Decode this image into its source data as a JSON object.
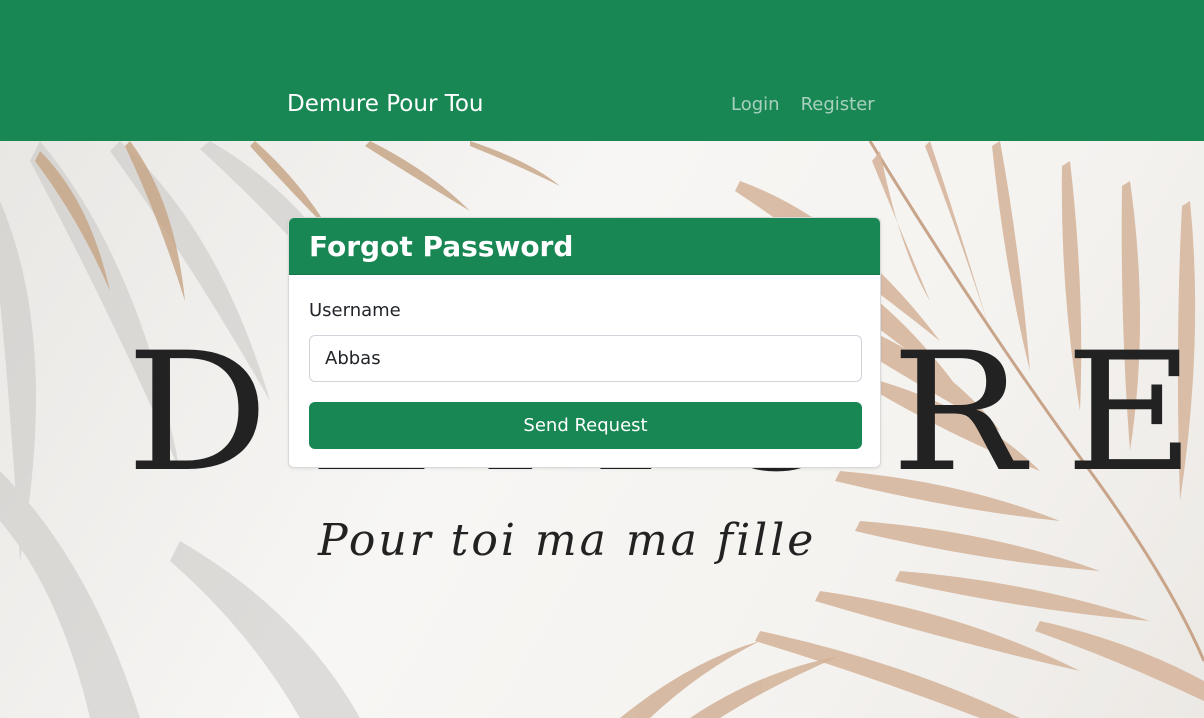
{
  "navbar": {
    "brand": "Demure Pour Tou",
    "links": [
      {
        "label": "Login"
      },
      {
        "label": "Register"
      }
    ],
    "color": "#198754"
  },
  "hero": {
    "logo_word": "DEMURE",
    "tagline": "Pour toi ma ma fille"
  },
  "card": {
    "title": "Forgot Password",
    "username_label": "Username",
    "username_value": "Abbas",
    "submit_label": "Send Request"
  }
}
